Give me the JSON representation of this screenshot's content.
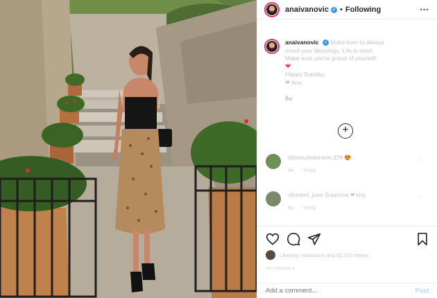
{
  "header": {
    "username": "anaivanovic",
    "verified_mark": "✓",
    "separator": "•",
    "follow_status": "Following",
    "more_icon": "⋯"
  },
  "caption": {
    "username": "anaivanovic",
    "lines": [
      "Make sure to always",
      "count your blessings. Life is short.",
      "Make sure you're proud of yourself."
    ],
    "heart": "❤",
    "line_happy": "Happy Sunday,",
    "line_sign": "❤ Ana",
    "age": "8w"
  },
  "load_more_icon": "+",
  "comments": [
    {
      "username": "ljiljana.todorovic.276",
      "text": "😍",
      "age": "8w",
      "reply": "Reply",
      "like_icon": "♡"
    },
    {
      "username": "clement_juan",
      "text": "Sueprime ❤ kiss",
      "age": "8w",
      "reply": "Reply",
      "like_icon": "♡"
    }
  ],
  "actions": {
    "like_icon": "heart-outline-icon",
    "comment_icon": "comment-icon",
    "share_icon": "paper-plane-icon",
    "save_icon": "bookmark-icon"
  },
  "likes": {
    "text": "Liked by marinacret and 62,762 others"
  },
  "date": "SEPTEMBER 8",
  "add_comment": {
    "placeholder": "Add a comment...",
    "post_label": "Post"
  },
  "colors": {
    "accent_blue": "#3897f0",
    "post_disabled": "#b2dffc",
    "heart_red": "#ed4956"
  }
}
